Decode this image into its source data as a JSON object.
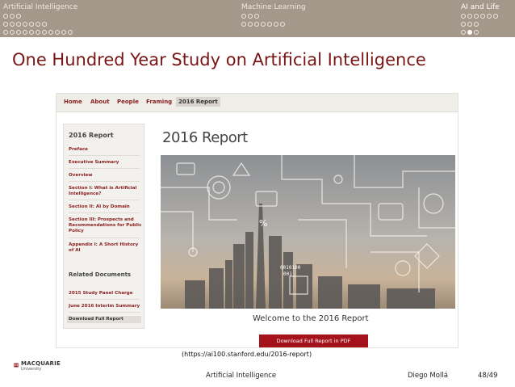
{
  "nav": {
    "sections": [
      {
        "title": "Artificial Intelligence",
        "rows": [
          3,
          7,
          11
        ],
        "filled": []
      },
      {
        "title": "Machine Learning",
        "rows": [
          3,
          7
        ],
        "filled": []
      },
      {
        "title": "AI and Life",
        "rows": [
          6,
          3,
          3
        ],
        "filled": [
          [
            2,
            1
          ]
        ],
        "active": true
      }
    ]
  },
  "slide": {
    "title": "One Hundred Year Study on Artificial Intelligence",
    "caption": "(https://ai100.stanford.edu/2016-report)"
  },
  "website": {
    "nav_items": [
      "Home",
      "About",
      "People",
      "Framing",
      "2016 Report"
    ],
    "sidebar_heading": "2016 Report",
    "sidebar_items": [
      "Preface",
      "Executive Summary",
      "Overview",
      "Section I: What is Artificial Intelligence?",
      "Section II: AI by Domain",
      "Section III: Prospects and Recommendations for Public Policy",
      "Appendix I: A Short History of AI"
    ],
    "related_heading": "Related Documents",
    "related_items": [
      "2015 Study Panel Charge",
      "June 2016 Interim Summary",
      "Download Full Report"
    ],
    "page_title": "2016 Report",
    "hero_text": {
      "percent": "%",
      "binary_1": "0010100",
      "binary_2": "001"
    },
    "welcome": "Welcome to the 2016 Report",
    "download_button": "Download Full Report in PDF"
  },
  "footer": {
    "logo_word": "MACQUARIE",
    "logo_sub": "University",
    "title": "Artificial Intelligence",
    "author": "Diego Mollá",
    "page": "48/49"
  },
  "colors": {
    "nav_bar": "#a4988a",
    "title_red": "#7a1515",
    "link_red": "#8a2020",
    "button_red": "#a4121b"
  }
}
